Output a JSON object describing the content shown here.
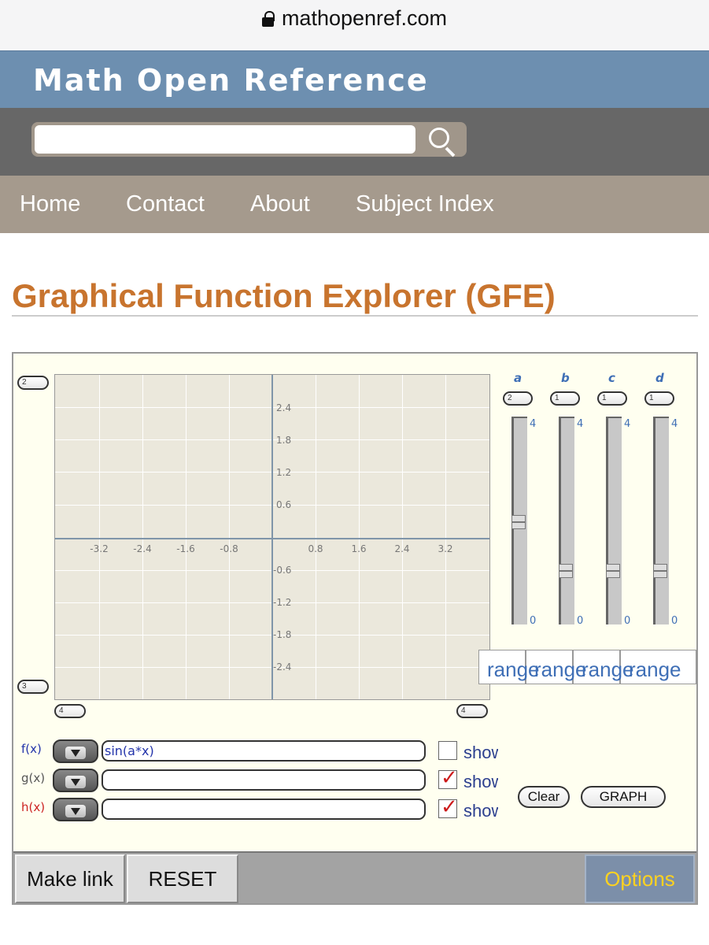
{
  "browser": {
    "url": "mathopenref.com"
  },
  "site": {
    "title": "Math Open Reference",
    "search": {
      "value": "",
      "placeholder": ""
    },
    "nav": [
      "Home",
      "Contact",
      "About",
      "Subject Index"
    ]
  },
  "page": {
    "title": "Graphical Function Explorer (GFE)"
  },
  "graph": {
    "x_ticks": [
      "-3.2",
      "-2.4",
      "-1.6",
      "-0.8",
      "0.8",
      "1.6",
      "2.4",
      "3.2"
    ],
    "y_ticks": [
      "2.4",
      "1.8",
      "1.2",
      "0.6",
      "-0.6",
      "-1.2",
      "-1.8",
      "-2.4"
    ],
    "axis_color": "#7f95a9",
    "background_color": "#ebe8dc",
    "corner_controls": {
      "y_max": "2",
      "y_min": "3",
      "x_min": "4",
      "x_max": "4"
    }
  },
  "params": [
    {
      "name": "a",
      "value_field": "2",
      "max": "4",
      "min": "0",
      "range_label": "range",
      "slider_level": 0.5
    },
    {
      "name": "b",
      "value_field": "1",
      "max": "4",
      "min": "0",
      "range_label": "range",
      "slider_level": 0.25
    },
    {
      "name": "c",
      "value_field": "1",
      "max": "4",
      "min": "0",
      "range_label": "range",
      "slider_level": 0.25
    },
    {
      "name": "d",
      "value_field": "1",
      "max": "4",
      "min": "0",
      "range_label": "range",
      "slider_level": 0.25
    }
  ],
  "functions": [
    {
      "label": "f(x)",
      "color": "#2233aa",
      "expression": "sin(a*x)",
      "show_checked": false,
      "show_label": "show"
    },
    {
      "label": "g(x)",
      "color": "#555555",
      "expression": "",
      "show_checked": true,
      "show_label": "show"
    },
    {
      "label": "h(x)",
      "color": "#cc2222",
      "expression": "",
      "show_checked": true,
      "show_label": "show"
    }
  ],
  "buttons": {
    "clear": "Clear",
    "graph": "GRAPH",
    "make_link": "Make link",
    "reset": "RESET",
    "options": "Options"
  },
  "colors": {
    "header_blue": "#6d8fb0",
    "search_bar": "#676767",
    "nav_bar": "#a59a8d",
    "title_orange": "#c8742e",
    "param_blue": "#3f6fb6",
    "options_text": "#ffd21f"
  }
}
